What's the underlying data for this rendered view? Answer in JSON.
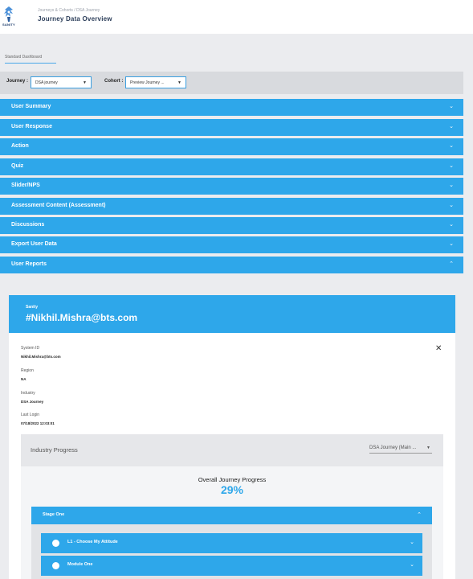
{
  "header": {
    "logo_text": "SANITY",
    "breadcrumb": "Journeys & Cohorts / DSA Journey",
    "title": "Journey Data Overview"
  },
  "tabs": [
    {
      "label": "Standard Dashboard"
    }
  ],
  "filters": {
    "journey_label": "Journey :",
    "journey_value": "DSA journey",
    "cohort_label": "Cohort :",
    "cohort_value": "Preview Journey ..."
  },
  "accordions": [
    {
      "label": "User Summary",
      "expanded": false
    },
    {
      "label": "User Response",
      "expanded": false
    },
    {
      "label": "Action",
      "expanded": false
    },
    {
      "label": "Quiz",
      "expanded": false
    },
    {
      "label": "Slider/NPS",
      "expanded": false
    },
    {
      "label": "Assessment Content (Assessment)",
      "expanded": false
    },
    {
      "label": "Discussions",
      "expanded": false
    },
    {
      "label": "Export User Data",
      "expanded": false
    },
    {
      "label": "User Reports",
      "expanded": true
    }
  ],
  "icons": {
    "collapsed": "chevron-down-icon",
    "expanded": "chevron-up-icon",
    "close": "close-icon"
  },
  "profile": {
    "org": "Sanity",
    "username": "#Nikhil.Mishra@bts.com",
    "fields": [
      {
        "label": "System ID",
        "value": "Nikhil.Mishra@bts.com"
      },
      {
        "label": "Region",
        "value": "NA"
      },
      {
        "label": "Industry",
        "value": "DSA Journey"
      },
      {
        "label": "Last Login",
        "value": "07/18/2022 12:03:01"
      }
    ]
  },
  "progress": {
    "title": "Industry Progress",
    "journey_select": "DSA Journey (Main ...",
    "overall_label": "Overall Journey Progress",
    "overall_percent": "29%",
    "stage": {
      "label": "Stage One",
      "expanded": true
    },
    "modules": [
      {
        "label": "L1 - Choose My Attitude"
      },
      {
        "label": "Module One"
      }
    ]
  },
  "colors": {
    "accent": "#2ea7ea",
    "background": "#ebecef",
    "title": "#2c3e5a"
  }
}
